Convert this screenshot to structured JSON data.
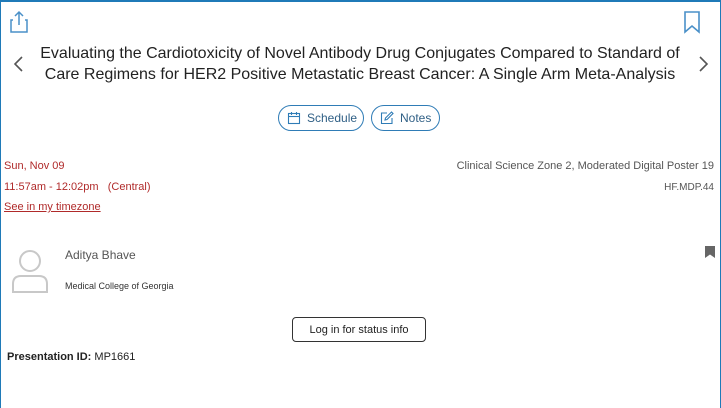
{
  "header": {
    "title": "Evaluating the Cardiotoxicity of Novel Antibody Drug Conjugates Compared to Standard of Care Regimens for HER2 Positive Metastatic Breast Cancer: A Single Arm Meta-Analysis",
    "icons": {
      "share": "share-icon",
      "bookmark": "bookmark-icon",
      "prev": "chevron-left-icon",
      "next": "chevron-right-icon"
    }
  },
  "actions": {
    "schedule_label": "Schedule",
    "notes_label": "Notes"
  },
  "session": {
    "date": "Sun, Nov 09",
    "time": "11:57am - 12:02pm   (Central)",
    "timezone_link": "See in my timezone",
    "location": "Clinical Science Zone 2, Moderated Digital Poster 19",
    "code": "HF.MDP.44"
  },
  "author": {
    "name": "Aditya Bhave",
    "affiliation": "Medical College of Georgia"
  },
  "login_label": "Log in for status info",
  "presentation": {
    "id_label": "Presentation ID:",
    "id_value": "MP1661"
  },
  "colors": {
    "accent": "#2f7cb6",
    "date_red": "#b02a2a",
    "frame_blue": "#1f7ab8"
  }
}
